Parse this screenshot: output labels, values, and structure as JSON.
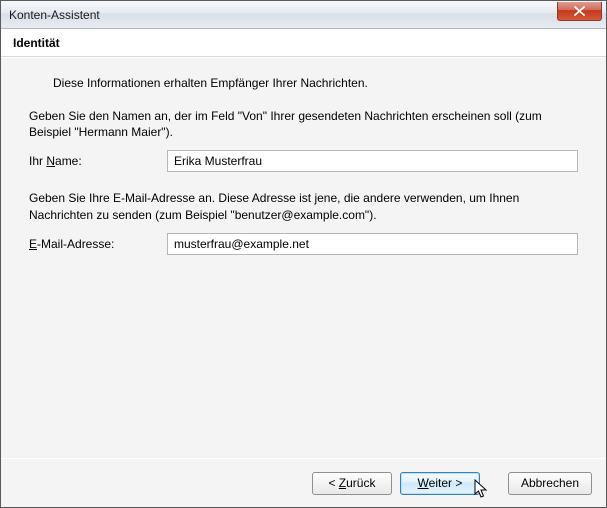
{
  "window": {
    "title": "Konten-Assistent"
  },
  "header": {
    "title": "Identität"
  },
  "intro": "Diese Informationen erhalten Empfänger Ihrer Nachrichten.",
  "name_section": {
    "para": "Geben Sie den Namen an, der im Feld \"Von\" Ihrer gesendeten Nachrichten erscheinen soll (zum Beispiel \"Hermann Maier\").",
    "label_prefix": "Ihr ",
    "label_ul": "N",
    "label_suffix": "ame:",
    "value": "Erika Musterfrau"
  },
  "email_section": {
    "para": "Geben Sie Ihre E-Mail-Adresse an. Diese Adresse ist jene, die andere verwenden, um Ihnen Nachrichten zu senden (zum Beispiel \"benutzer@example.com\").",
    "label_ul": "E",
    "label_suffix": "-Mail-Adresse:",
    "value": "musterfrau@example.net"
  },
  "buttons": {
    "back_prefix": "< ",
    "back_ul": "Z",
    "back_suffix": "urück",
    "next_ul": "W",
    "next_suffix": "eiter >",
    "cancel": "Abbrechen"
  }
}
